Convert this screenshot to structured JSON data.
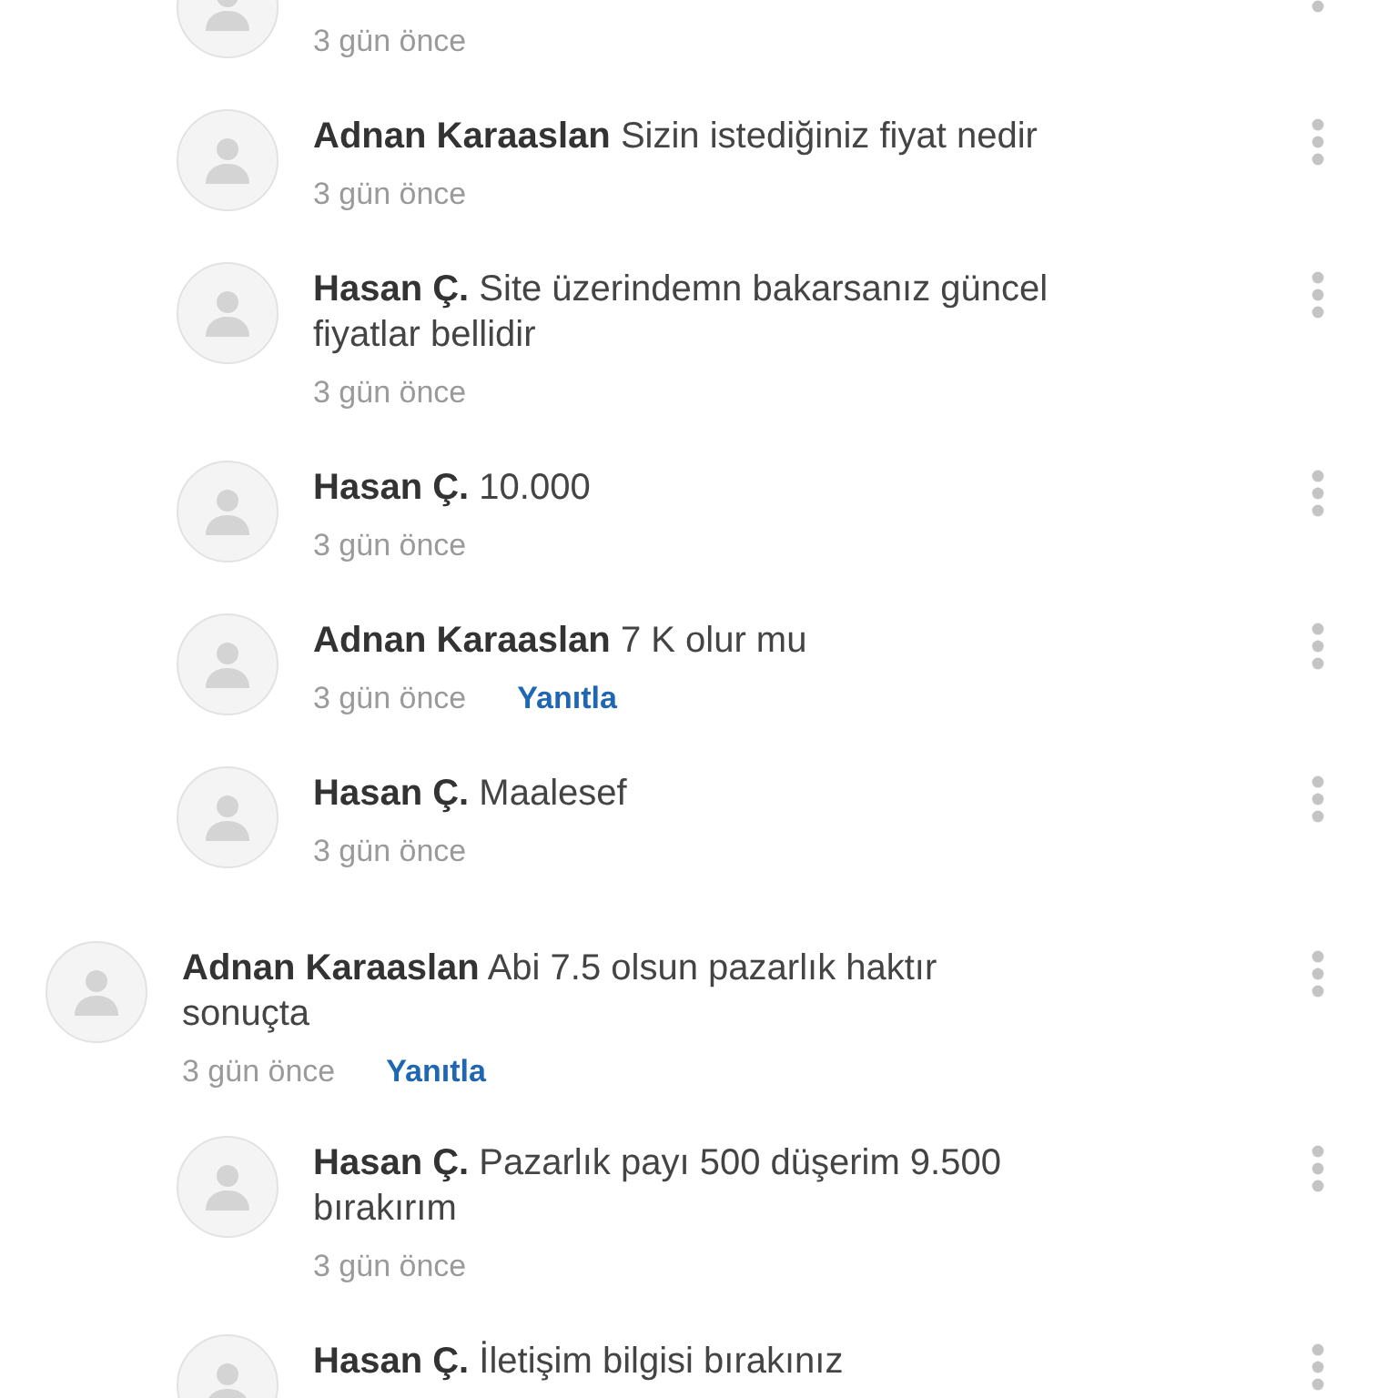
{
  "comments": [
    {
      "kind": "reply",
      "time": "3 gün önce"
    },
    {
      "kind": "reply",
      "author": "Adnan Karaaslan",
      "text": "Sizin istediğiniz fiyat nedir",
      "time": "3 gün önce"
    },
    {
      "kind": "reply",
      "author": "Hasan Ç.",
      "text": "Site üzerindemn bakarsanız güncel fiyatlar bellidir",
      "time": "3 gün önce"
    },
    {
      "kind": "reply",
      "author": "Hasan Ç.",
      "text": "10.000",
      "time": "3 gün önce"
    },
    {
      "kind": "reply",
      "author": "Adnan Karaaslan",
      "text": "7 K olur mu",
      "time": "3 gün önce",
      "reply_link": "Yanıtla"
    },
    {
      "kind": "reply",
      "author": "Hasan Ç.",
      "text": "Maalesef",
      "time": "3 gün önce"
    },
    {
      "kind": "top",
      "author": "Adnan Karaaslan",
      "text": "Abi 7.5 olsun pazarlık haktır sonuçta",
      "time": "3 gün önce",
      "reply_link": "Yanıtla"
    },
    {
      "kind": "reply",
      "author": "Hasan Ç.",
      "text": "Pazarlık payı 500 düşerim 9.500 bırakırım",
      "time": "3 gün önce"
    },
    {
      "kind": "reply",
      "author": "Hasan Ç.",
      "text": "İletişim bilgisi bırakınız"
    }
  ]
}
